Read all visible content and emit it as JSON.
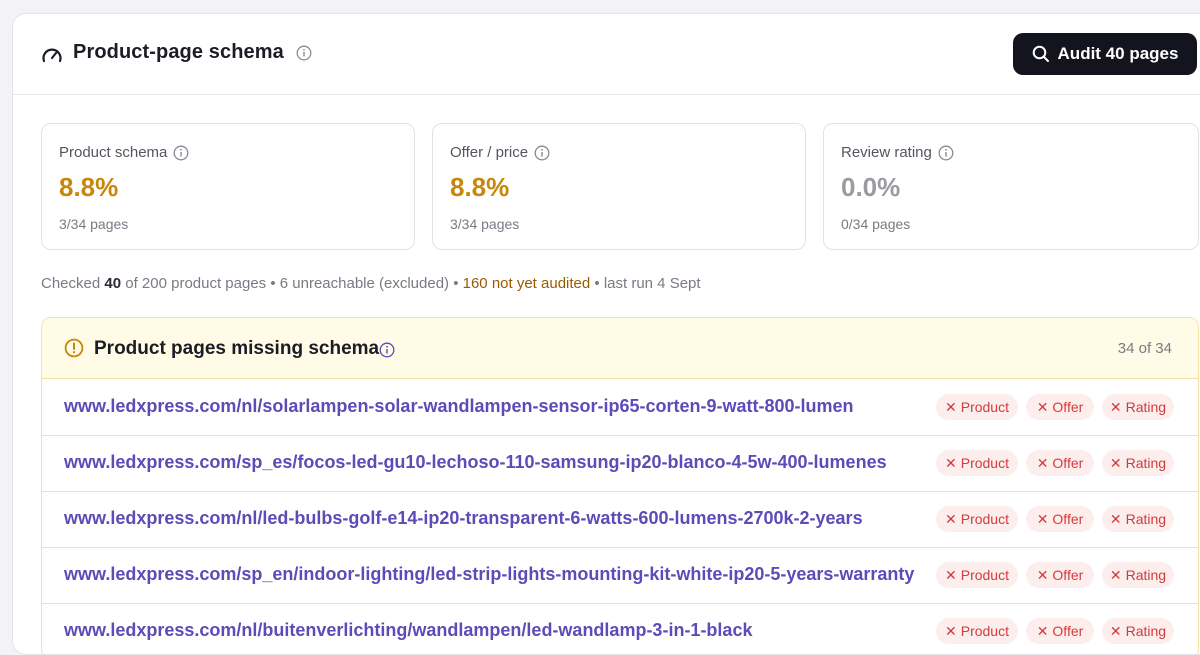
{
  "header": {
    "title": "Product-page schema",
    "audit_button_label": "Audit 40 pages"
  },
  "metrics": [
    {
      "label": "Product schema",
      "value": "8.8%",
      "sub": "3/34 pages",
      "color": "#c8860a"
    },
    {
      "label": "Offer / price",
      "value": "8.8%",
      "sub": "3/34 pages",
      "color": "#c8860a"
    },
    {
      "label": "Review rating",
      "value": "0.0%",
      "sub": "0/34 pages",
      "color": "#9a9aa2"
    }
  ],
  "summary": {
    "prefix": "Checked ",
    "checked": "40",
    "mid": " of 200 product pages • 6 unreachable (excluded) • ",
    "not_audited": "160 not yet audited",
    "suffix": " • last run 4 Sept"
  },
  "panel": {
    "title": "Product pages missing schema",
    "count": "34 of 34",
    "badge_product": "Product",
    "badge_offer": "Offer",
    "badge_rating": "Rating",
    "rows": [
      {
        "url": "www.ledxpress.com/nl/solarlampen-solar-wandlampen-sensor-ip65-corten-9-watt-800-lumen"
      },
      {
        "url": "www.ledxpress.com/sp_es/focos-led-gu10-lechoso-110-samsung-ip20-blanco-4-5w-400-lumenes"
      },
      {
        "url": "www.ledxpress.com/nl/led-bulbs-golf-e14-ip20-transparent-6-watts-600-lumens-2700k-2-years"
      },
      {
        "url": "www.ledxpress.com/sp_en/indoor-lighting/led-strip-lights-mounting-kit-white-ip20-5-years-warranty"
      },
      {
        "url": "www.ledxpress.com/nl/buitenverlichting/wandlampen/led-wandlamp-3-in-1-black"
      }
    ]
  },
  "colors": {
    "accent_dark": "#14141e",
    "link": "#5b4cb8",
    "warning": "#c8860a",
    "badge_bg": "#fdeeee",
    "badge_text": "#d13b3b"
  }
}
